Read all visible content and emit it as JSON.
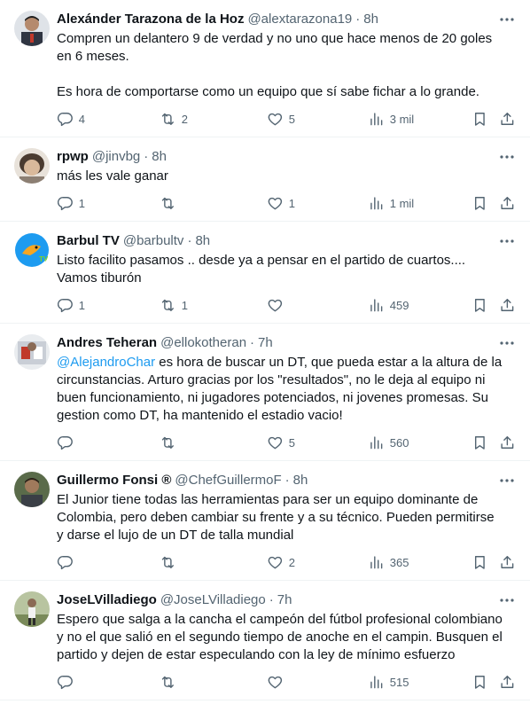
{
  "tweets": [
    {
      "name": "Alexánder Tarazona de la Hoz",
      "handle": "@alextarazona19",
      "time": "8h",
      "text": "Compren un delantero 9 de verdad y no uno que hace menos de 20 goles\nen 6 meses.\n\nEs hora de comportarse como un equipo que sí sabe fichar a lo grande.",
      "replies": "4",
      "reposts": "2",
      "likes": "5",
      "views": "3 mil",
      "avatar_color": "#3b3f4a"
    },
    {
      "name": "rpwp",
      "handle": "@jinvbg",
      "time": "8h",
      "text": "más les vale ganar",
      "replies": "1",
      "reposts": "",
      "likes": "1",
      "views": "1 mil",
      "avatar_color": "#8c7f73"
    },
    {
      "name": "Barbul TV",
      "handle": "@barbultv",
      "time": "8h",
      "text": "Listo facilito pasamos .. desde ya a pensar en el partido de cuartos....\nVamos tiburón",
      "replies": "1",
      "reposts": "1",
      "likes": "",
      "views": "459",
      "avatar_color": "#1d9bf0"
    },
    {
      "name": "Andres Teheran",
      "handle": "@ellokotheran",
      "time": "7h",
      "mention": "@AlejandroChar",
      "text": " es hora de buscar un DT, que pueda estar a la altura de la\ncircunstancias. Arturo gracias por los \"resultados\", no le deja al equipo ni\nbuen funcionamiento, ni jugadores potenciados, ni jovenes promesas. Su\ngestion como DT, ha mantenido el estadio vacio!",
      "replies": "",
      "reposts": "",
      "likes": "5",
      "views": "560",
      "avatar_color": "#c9ced6"
    },
    {
      "name": "Guillermo Fonsi ®",
      "handle": "@ChefGuillermoF",
      "time": "8h",
      "text": "El Junior tiene todas las herramientas para ser un equipo dominante de\nColombia, pero deben cambiar su frente y a su técnico. Pueden permitirse\ny darse el lujo de un DT de talla mundial",
      "replies": "",
      "reposts": "",
      "likes": "2",
      "views": "365",
      "avatar_color": "#6b5a4a"
    },
    {
      "name": "JoseLVilladiego",
      "handle": "@JoseLVilladiego",
      "time": "7h",
      "text": "Espero que salga a la cancha el campeón del fútbol profesional colombiano\ny no el que salió en el segundo tiempo de anoche en el campin. Busquen el\npartido y dejen de estar especulando con la ley de mínimo esfuerzo",
      "replies": "",
      "reposts": "",
      "likes": "",
      "views": "515",
      "avatar_color": "#7a8a5a"
    }
  ],
  "icons": {
    "reply": "reply-icon",
    "repost": "repost-icon",
    "like": "like-icon",
    "views": "views-icon",
    "bookmark": "bookmark-icon",
    "share": "share-icon",
    "more": "more-icon"
  }
}
